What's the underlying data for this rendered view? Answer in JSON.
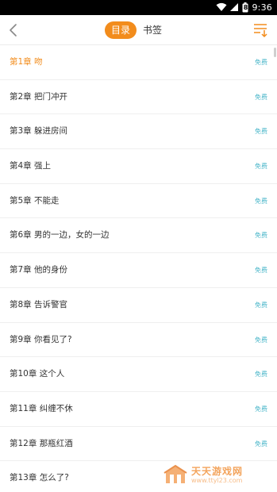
{
  "status_bar": {
    "time": "9:36",
    "battery_level": "8"
  },
  "header": {
    "tabs": [
      {
        "label": "目录",
        "active": true
      },
      {
        "label": "书签",
        "active": false
      }
    ]
  },
  "chapters": [
    {
      "title": "第1章 吻",
      "badge": "免费"
    },
    {
      "title": "第2章 把门冲开",
      "badge": "免费"
    },
    {
      "title": "第3章 躲进房间",
      "badge": "免费"
    },
    {
      "title": "第4章 强上",
      "badge": "免费"
    },
    {
      "title": "第5章 不能走",
      "badge": "免费"
    },
    {
      "title": "第6章 男的一边，女的一边",
      "badge": "免费"
    },
    {
      "title": "第7章 他的身份",
      "badge": "免费"
    },
    {
      "title": "第8章 告诉警官",
      "badge": "免费"
    },
    {
      "title": "第9章 你看见了?",
      "badge": "免费"
    },
    {
      "title": "第10章 这个人",
      "badge": "免费"
    },
    {
      "title": "第11章 纠缠不休",
      "badge": "免费"
    },
    {
      "title": "第12章 那瓶红酒",
      "badge": "免费"
    },
    {
      "title": "第13章 怎么了?",
      "badge": ""
    }
  ],
  "watermark": {
    "name": "天天游戏网",
    "url": "www.ttyl23.com"
  },
  "colors": {
    "accent": "#f28c1c",
    "free_badge": "#49b6c9"
  }
}
